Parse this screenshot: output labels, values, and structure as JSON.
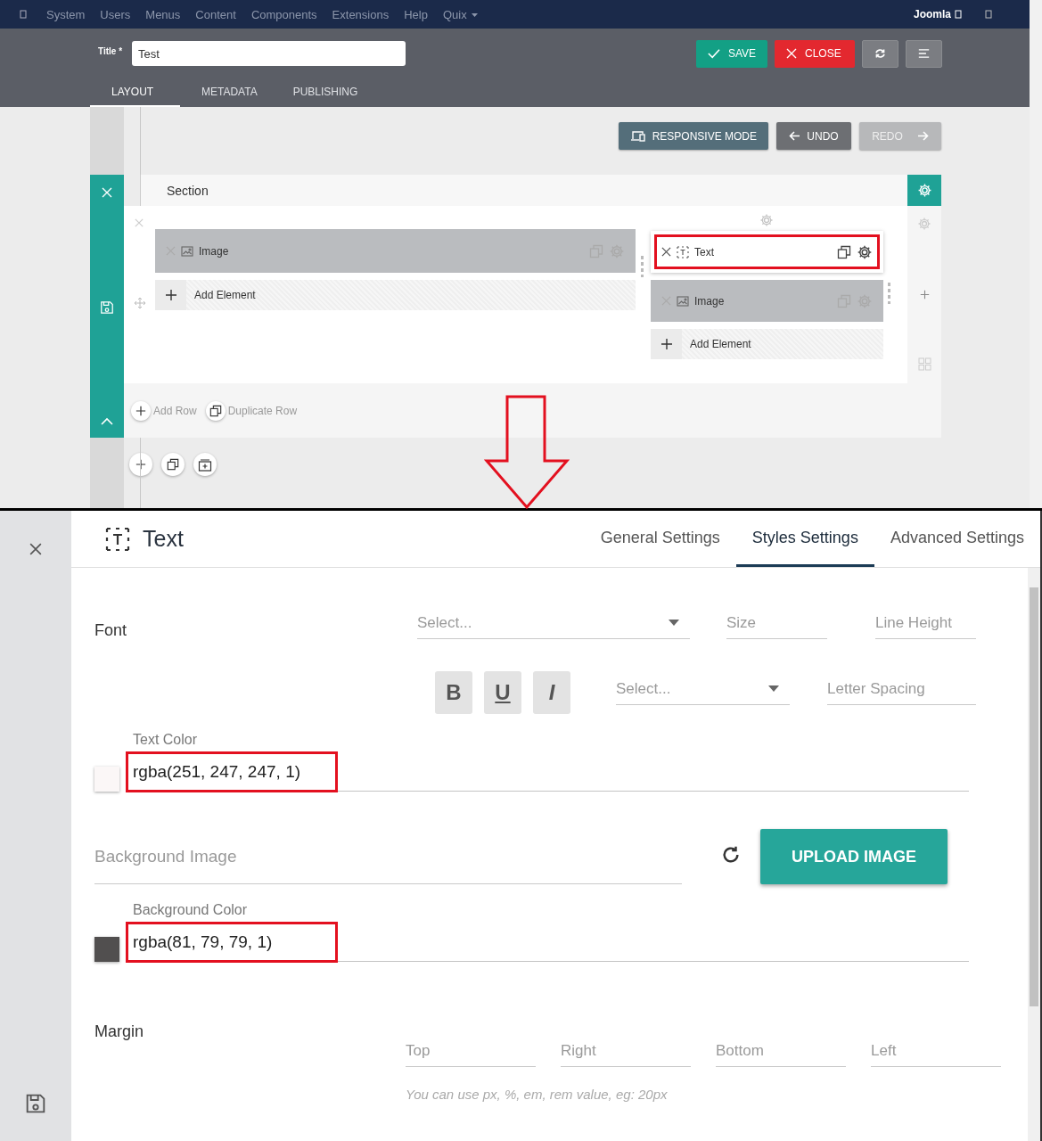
{
  "admin_menu": {
    "items": [
      "System",
      "Users",
      "Menus",
      "Content",
      "Components",
      "Extensions",
      "Help",
      "Quix"
    ],
    "site_label": "Joomla"
  },
  "toolbar": {
    "title_label": "Title *",
    "title_value": "Test",
    "buttons": [
      {
        "kind": "save",
        "label": "SAVE"
      },
      {
        "kind": "close",
        "label": "CLOSE"
      },
      {
        "kind": "refresh"
      },
      {
        "kind": "menu"
      }
    ]
  },
  "tabs": [
    {
      "label": "LAYOUT",
      "selected": true
    },
    {
      "label": "METADATA",
      "selected": false
    },
    {
      "label": "PUBLISHING",
      "selected": false
    }
  ],
  "builder": {
    "buttons": [
      {
        "kind": "responsive",
        "label": "RESPONSIVE MODE",
        "disabled": false
      },
      {
        "kind": "undo",
        "label": "UNDO",
        "disabled": false
      },
      {
        "kind": "redo",
        "label": "REDO",
        "disabled": true
      }
    ],
    "section": {
      "title": "Section",
      "columns": [
        {
          "elements": [
            {
              "kind": "image",
              "label": "Image",
              "selected": false,
              "highlighted": false
            }
          ],
          "add_label": "Add Element"
        },
        {
          "elements": [
            {
              "kind": "text",
              "label": "Text",
              "selected": true,
              "highlighted": true
            },
            {
              "kind": "image",
              "label": "Image",
              "selected": false,
              "highlighted": false
            }
          ],
          "add_label": "Add Element"
        }
      ]
    },
    "row_actions": [
      {
        "kind": "add",
        "label": "Add Row"
      },
      {
        "kind": "duplicate",
        "label": "Duplicate Row"
      }
    ]
  },
  "panel": {
    "title": "Text",
    "tabs": [
      {
        "label": "General Settings",
        "selected": false
      },
      {
        "label": "Styles Settings",
        "selected": true
      },
      {
        "label": "Advanced Settings",
        "selected": false
      }
    ],
    "font": {
      "label": "Font",
      "family_placeholder": "Select...",
      "size_placeholder": "Size",
      "line_height_placeholder": "Line Height",
      "style_buttons": [
        {
          "kind": "bold",
          "label": "B"
        },
        {
          "kind": "underline",
          "label": "U"
        },
        {
          "kind": "italic",
          "label": "I"
        }
      ],
      "weight_placeholder": "Select...",
      "letter_spacing_placeholder": "Letter Spacing"
    },
    "text_color": {
      "label": "Text Color",
      "value": "rgba(251, 247, 247, 1)",
      "color": "#fbf7f7",
      "highlighted": true
    },
    "background_image": {
      "placeholder": "Background Image",
      "upload_label": "UPLOAD IMAGE"
    },
    "background_color": {
      "label": "Background Color",
      "value": "rgba(81, 79, 79, 1)",
      "color": "#514f4f",
      "highlighted": true
    },
    "margin": {
      "label": "Margin",
      "placeholders": [
        "Top",
        "Right",
        "Bottom",
        "Left"
      ],
      "hint": "You can use px, %, em, rem value, eg: 20px"
    }
  }
}
